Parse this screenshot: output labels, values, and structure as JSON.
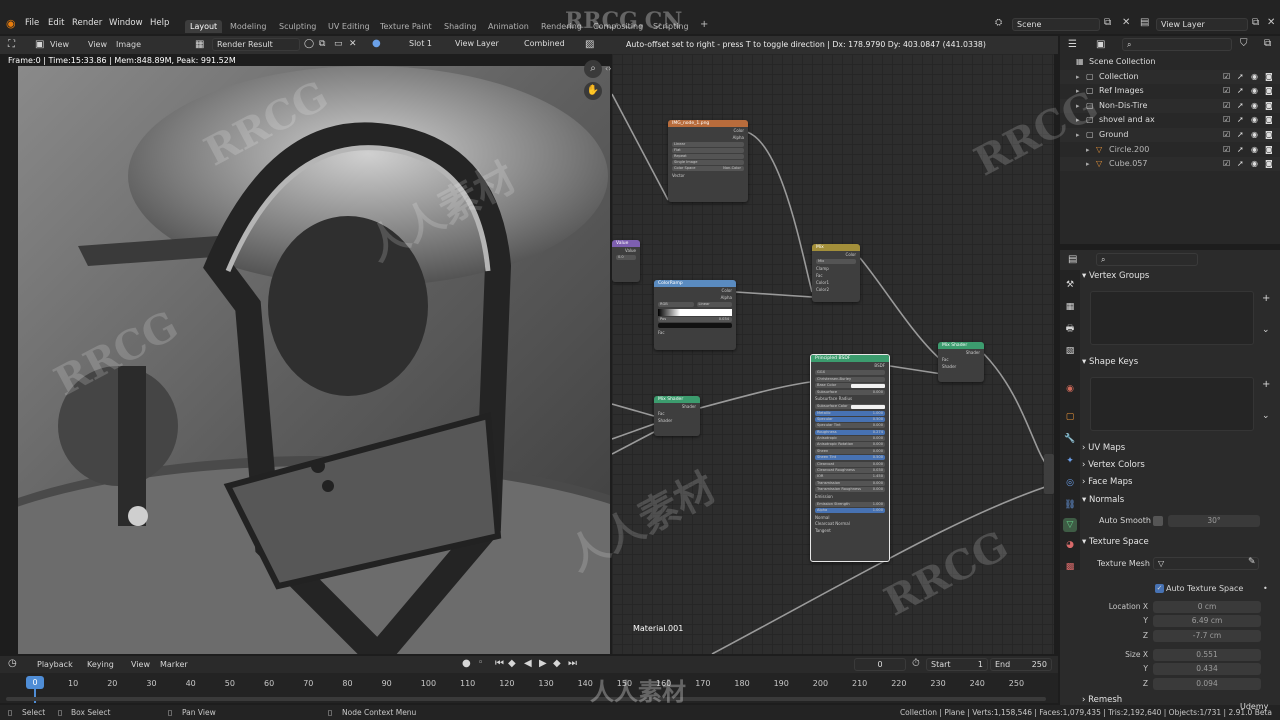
{
  "menu": [
    "File",
    "Edit",
    "Render",
    "Window",
    "Help"
  ],
  "workspace_tabs": [
    "Layout",
    "Modeling",
    "Sculpting",
    "UV Editing",
    "Texture Paint",
    "Shading",
    "Animation",
    "Rendering",
    "Compositing",
    "Scripting"
  ],
  "active_workspace": "Layout",
  "scene": "Scene",
  "view_layer": "View Layer",
  "image_editor": {
    "menus": [
      "View",
      "View",
      "Image"
    ],
    "image_name": "Render Result",
    "slot": "Slot 1",
    "layer": "View Layer",
    "pass": "Combined",
    "render_info": "Frame:0 | Time:15:33.86 | Mem:848.89M, Peak: 991.52M"
  },
  "node_editor": {
    "status_text": "Auto-offset set to right - press T to toggle direction | Dx: 178.9790  Dy: 403.0847 (441.0338)",
    "material_label": "Material.001",
    "nodes": {
      "image_texture": {
        "title": "IMG_node_1.png",
        "outputs": [
          "Color",
          "Alpha"
        ],
        "rows": [
          "Linear",
          "Flat",
          "Repeat",
          "Single Image"
        ],
        "color_space_label": "Color Space",
        "color_space_value": "Non-Color",
        "vector": "Vector"
      },
      "value": {
        "title": "Value",
        "out": "Value",
        "val": "0.0"
      },
      "mix": {
        "title": "Mix",
        "out": "Color",
        "rows": [
          "Mix",
          "Clamp",
          "Fac",
          "Color1",
          "Color2"
        ]
      },
      "color_ramp": {
        "title": "ColorRamp",
        "outputs": [
          "Color",
          "Alpha"
        ],
        "mode": "RGB",
        "interp": "Linear",
        "pos_label": "Pos",
        "pos": "0.034",
        "fac": "Fac"
      },
      "mix_shader_1": {
        "title": "Mix Shader",
        "out": "Shader",
        "rows": [
          "Fac",
          "Shader",
          "Shader"
        ]
      },
      "mix_shader_2": {
        "title": "Mix Shader",
        "out": "Shader",
        "rows": [
          "Fac",
          "Shader",
          "Shader"
        ]
      },
      "principled": {
        "title": "Principled BSDF",
        "out": "BSDF",
        "rows": [
          {
            "label": "GGX",
            "kind": "bar",
            "value": ""
          },
          {
            "label": "Christensen-Burley",
            "kind": "bar",
            "value": ""
          },
          {
            "label": "Base Color",
            "kind": "color",
            "value": ""
          },
          {
            "label": "Subsurface",
            "kind": "bar",
            "value": "0.000"
          },
          {
            "label": "Subsurface Radius",
            "kind": "plain",
            "value": ""
          },
          {
            "label": "Subsurface Color",
            "kind": "color",
            "value": ""
          },
          {
            "label": "Metallic",
            "kind": "blue",
            "value": "1.000"
          },
          {
            "label": "Specular",
            "kind": "blue",
            "value": "0.500"
          },
          {
            "label": "Specular Tint",
            "kind": "bar",
            "value": "0.000"
          },
          {
            "label": "Roughness",
            "kind": "blue",
            "value": "0.274"
          },
          {
            "label": "Anisotropic",
            "kind": "bar",
            "value": "0.000"
          },
          {
            "label": "Anisotropic Rotation",
            "kind": "bar",
            "value": "0.000"
          },
          {
            "label": "Sheen",
            "kind": "bar",
            "value": "0.000"
          },
          {
            "label": "Sheen Tint",
            "kind": "blue",
            "value": "0.500"
          },
          {
            "label": "Clearcoat",
            "kind": "bar",
            "value": "0.000"
          },
          {
            "label": "Clearcoat Roughness",
            "kind": "bar",
            "value": "0.030"
          },
          {
            "label": "IOR",
            "kind": "bar",
            "value": "1.450"
          },
          {
            "label": "Transmission",
            "kind": "bar",
            "value": "0.000"
          },
          {
            "label": "Transmission Roughness",
            "kind": "bar",
            "value": "0.000"
          },
          {
            "label": "Emission",
            "kind": "plain",
            "value": ""
          },
          {
            "label": "Emission Strength",
            "kind": "bar",
            "value": "1.000"
          },
          {
            "label": "Alpha",
            "kind": "blue",
            "value": "1.000"
          },
          {
            "label": "Normal",
            "kind": "plain",
            "value": ""
          },
          {
            "label": "Clearcoat Normal",
            "kind": "plain",
            "value": ""
          },
          {
            "label": "Tangent",
            "kind": "plain",
            "value": ""
          }
        ]
      }
    }
  },
  "outliner": {
    "items": [
      {
        "label": "Scene Collection",
        "indent": 0
      },
      {
        "label": "Collection",
        "indent": 1
      },
      {
        "label": "Ref Images",
        "indent": 1
      },
      {
        "label": "Non-Dis-Tire",
        "indent": 1
      },
      {
        "label": "shovel and ax",
        "indent": 1
      },
      {
        "label": "Ground",
        "indent": 1
      },
      {
        "label": "Circle.200",
        "indent": 2
      },
      {
        "label": "Cube.057",
        "indent": 2
      }
    ]
  },
  "properties": {
    "vertex_groups": "Vertex Groups",
    "shape_keys": "Shape Keys",
    "uv_maps": "UV Maps",
    "vertex_colors": "Vertex Colors",
    "face_maps": "Face Maps",
    "normals": "Normals",
    "auto_smooth_label": "Auto Smooth",
    "auto_smooth_angle": "30°",
    "texture_space": "Texture Space",
    "texture_mesh_label": "Texture Mesh",
    "auto_texture_space": "Auto Texture Space",
    "location_label": "Location X",
    "location": [
      "0 cm",
      "6.49 cm",
      "-7.7 cm"
    ],
    "size_label": "Size X",
    "size": [
      "0.551",
      "0.434",
      "0.094"
    ],
    "axis_y": "Y",
    "axis_z": "Z",
    "remesh": "Remesh"
  },
  "timeline": {
    "menus": [
      "Playback",
      "Keying",
      "View",
      "Marker"
    ],
    "current_frame": "0",
    "start_label": "Start",
    "start": "1",
    "end_label": "End",
    "end": "250",
    "playhead": "0",
    "ticks": [
      "10",
      "20",
      "30",
      "40",
      "50",
      "60",
      "70",
      "80",
      "90",
      "100",
      "110",
      "120",
      "130",
      "140",
      "150",
      "160",
      "170",
      "180",
      "190",
      "200",
      "210",
      "220",
      "230",
      "240",
      "250"
    ]
  },
  "statusbar": {
    "select": "Select",
    "box_select": "Box Select",
    "pan_view": "Pan View",
    "node_context": "Node Context Menu",
    "stats": "Collection | Plane | Verts:1,158,546 | Faces:1,079,435 | Tris:2,192,640 | Objects:1/731 | 2.91.0 Beta"
  },
  "watermarks": [
    "RRCG",
    "人人素材",
    "RRCG.CN",
    "人人素材",
    "Udemy"
  ],
  "colors": {
    "accent": "#4772b3",
    "active_tab": "#3d3d3d",
    "playhead": "#4f8dd6",
    "node_image": "#b86c3c",
    "node_mix": "#a38f3a",
    "node_input": "#7d5fb0",
    "node_converter": "#5a8bc0",
    "node_shader": "#3c9c6e"
  }
}
